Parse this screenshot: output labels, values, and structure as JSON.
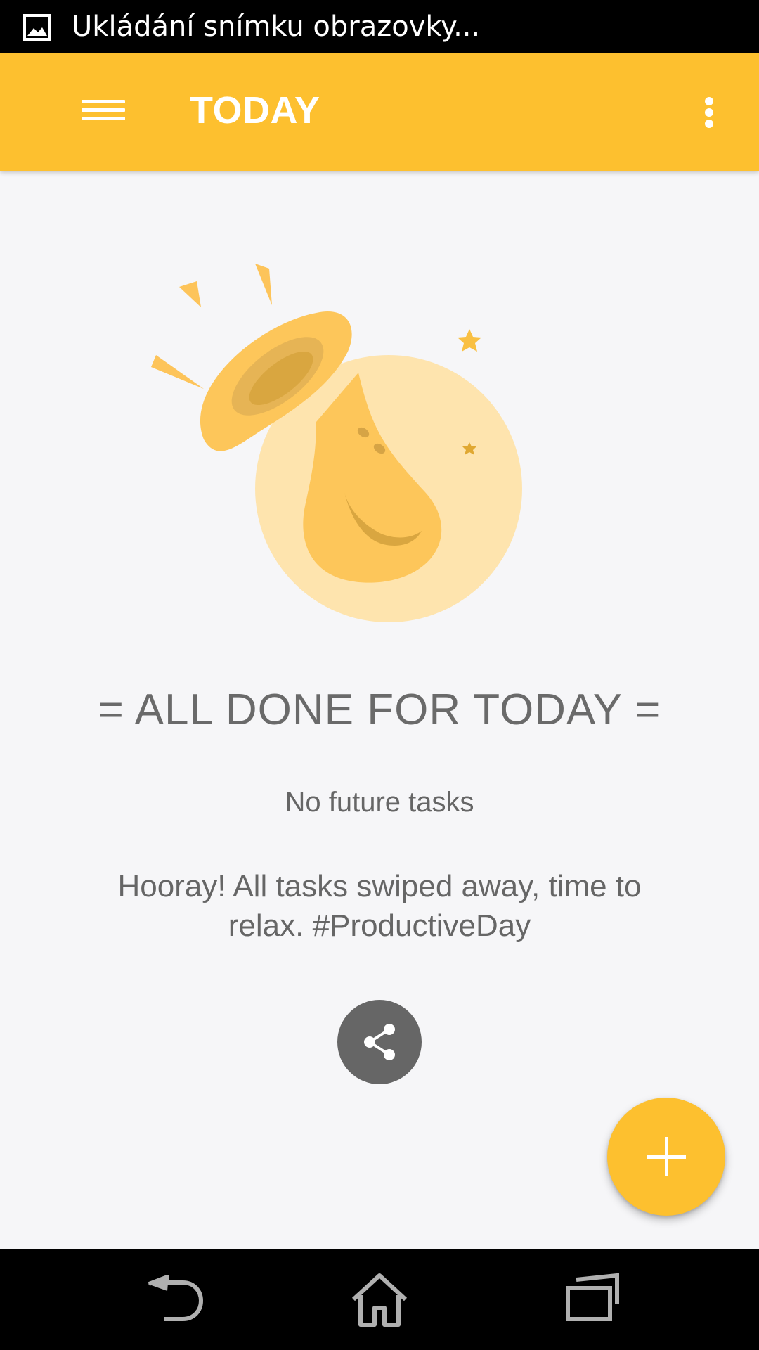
{
  "status_bar": {
    "notification_text": "Ukládání snímku obrazovky...",
    "notification_icon": "image-icon"
  },
  "app_bar": {
    "title": "TODAY",
    "menu_icon": "hamburger-menu-icon",
    "overflow_icon": "more-vert-icon",
    "background_color": "#fdc02f"
  },
  "empty_state": {
    "headline": "= ALL DONE FOR TODAY =",
    "subtitle": "No future tasks",
    "message": "Hooray! All tasks swiped away, time to relax. #ProductiveDay",
    "share_icon": "share-icon",
    "illustration": "horn-illustration"
  },
  "fab": {
    "icon": "plus-icon",
    "color": "#fdc02f"
  },
  "nav_bar": {
    "items": [
      "back-icon",
      "home-icon",
      "recent-apps-icon"
    ]
  }
}
